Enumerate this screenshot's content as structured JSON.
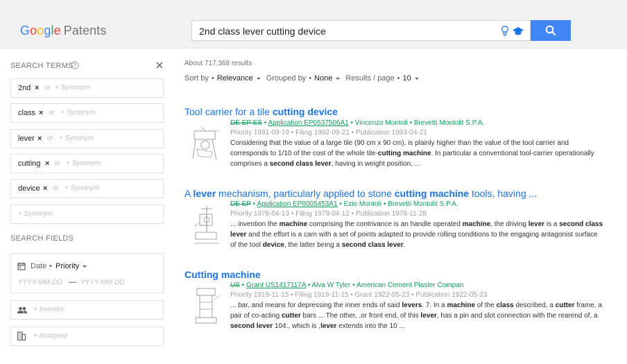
{
  "header": {
    "logo_letters": [
      "G",
      "o",
      "o",
      "g",
      "l",
      "e"
    ],
    "logo_product": "Patents",
    "search_value": "2nd class lever cutting device"
  },
  "sidebar": {
    "search_terms_title": "SEARCH TERMS",
    "terms": [
      {
        "word": "2nd",
        "or": "or",
        "synonym": "+ Synonym"
      },
      {
        "word": "class",
        "or": "or",
        "synonym": "+ Synonym"
      },
      {
        "word": "lever",
        "or": "or",
        "synonym": "+ Synonym"
      },
      {
        "word": "cutting",
        "or": "or",
        "synonym": "+ Synonym"
      },
      {
        "word": "device",
        "or": "or",
        "synonym": "+ Synonym"
      }
    ],
    "remove_symbol": "×",
    "new_synonym": "+ Synonym",
    "search_fields_title": "SEARCH FIELDS",
    "date_label": "Date",
    "date_dot": "•",
    "date_type": "Priority",
    "date_from_placeholder": "YYYY-MM-DD",
    "date_dash": "—",
    "date_to_placeholder": "YYYY-MM-DD",
    "inventor_placeholder": "+ Inventor",
    "assignee_placeholder": "+ Assignee"
  },
  "main": {
    "count": "About 717,368 results",
    "sort": {
      "sort_label": "Sort by",
      "sort_value": "Relevance",
      "group_label": "Grouped by",
      "group_value": "None",
      "per_page_label": "Results / page",
      "per_page_value": "10",
      "dot": "•"
    },
    "results": [
      {
        "title_parts": [
          [
            "Tool carrier for a tile ",
            false
          ],
          [
            "cutting device",
            true
          ]
        ],
        "countries": "DE EP ES",
        "sep": " • ",
        "publication": "Application EP0537506A1",
        "inventor": "Vincenzo Montoli",
        "assignee": "Brevetti Montolit S.P.A.",
        "dates": "Priority 1991-09-19 • Filing 1992-09-21 • Publication 1993-04-21",
        "snippet_parts": [
          [
            "Considering that the value of a large tile (90 cm x 90 cm), is plainly higher than the value of the tool carrier and corresponds to 1/10 of the cost of the whole tile-",
            false
          ],
          [
            "cutting machine",
            true
          ],
          [
            ". In particular a conventional tool-carrier operationally comprises a ",
            false
          ],
          [
            "second class lever",
            true
          ],
          [
            ", having in weight position, ...",
            false
          ]
        ]
      },
      {
        "title_parts": [
          [
            "A ",
            false
          ],
          [
            "lever",
            true
          ],
          [
            " mechanism, particularly applied to stone ",
            false
          ],
          [
            "cutting machine",
            true
          ],
          [
            " tools, having ...",
            false
          ]
        ],
        "countries": "DE EP",
        "sep": " • ",
        "publication": "Application EP0005453A1",
        "inventor": "Ezio Montoli",
        "assignee": "Brevetti Montolit S.P.A.",
        "dates": "Priority 1978-04-13 • Filing 1979-04-12 • Publication 1979-11-28",
        "snippet_parts": [
          [
            "... invention the ",
            false
          ],
          [
            "machine",
            true
          ],
          [
            " comprising the contrivance is an handle operated ",
            false
          ],
          [
            "machine",
            true
          ],
          [
            ", the driving ",
            false
          ],
          [
            "lever",
            true
          ],
          [
            " is a ",
            false
          ],
          [
            "second class lever",
            true
          ],
          [
            " and the effort is a cam with a set of points adapted to provide rolling conditions to the engaging antagonist surface of the tool ",
            false
          ],
          [
            "device",
            true
          ],
          [
            ", the latter being a ",
            false
          ],
          [
            "second class lever",
            true
          ],
          [
            ".",
            false
          ]
        ]
      },
      {
        "title_parts": [
          [
            "Cutting machine",
            true
          ]
        ],
        "countries": "US",
        "sep": " • ",
        "publication": "Grant US1417117A",
        "inventor": "Alva W Tyler",
        "assignee": "American Cement Plaster Compan",
        "dates": "Priority 1919-11-15 • Filing 1919-11-15 • Grant 1922-05-23 • Publication 1922-05-23",
        "snippet_parts": [
          [
            "... bar, and means for depressing the inner ends of said ",
            false
          ],
          [
            "levers",
            true
          ],
          [
            ". 7. In a ",
            false
          ],
          [
            "machine",
            true
          ],
          [
            " of the ",
            false
          ],
          [
            "class",
            true
          ],
          [
            " described, a ",
            false
          ],
          [
            "cutter",
            true
          ],
          [
            " frame, a pair of co-acting ",
            false
          ],
          [
            "cutter",
            true
          ],
          [
            " bars ... The other, ,or front end, of this ",
            false
          ],
          [
            "lever",
            true
          ],
          [
            ", has a pin and slot connection with the rearend of, a ",
            false
          ],
          [
            "second lever",
            true
          ],
          [
            " 104:, which is ,",
            false
          ],
          [
            "lever",
            true
          ],
          [
            " extends into the 10 ...",
            false
          ]
        ]
      }
    ]
  }
}
